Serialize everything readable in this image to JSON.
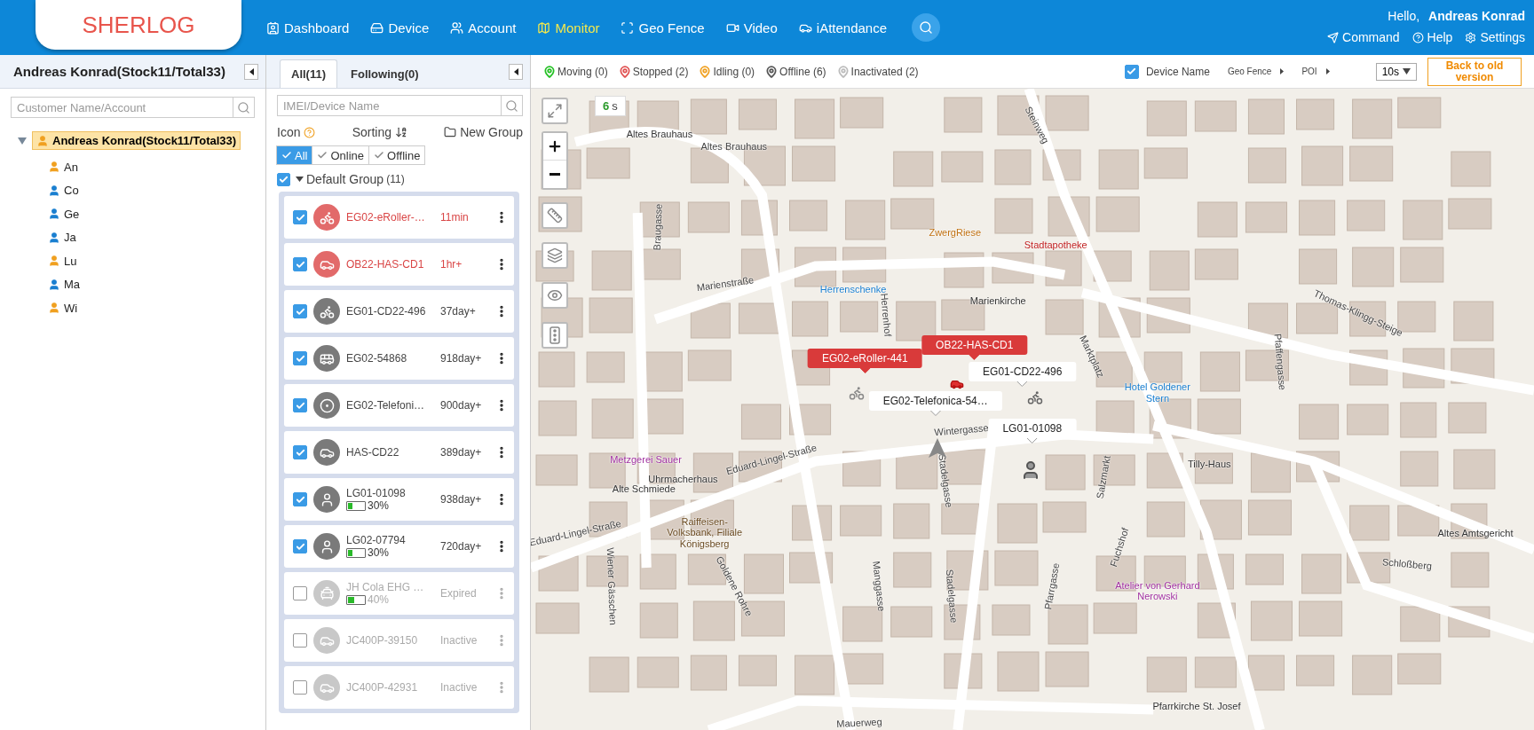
{
  "header": {
    "logo": "SHERLOG",
    "nav": [
      {
        "label": "Dashboard",
        "selected": false
      },
      {
        "label": "Device",
        "selected": false
      },
      {
        "label": "Account",
        "selected": false
      },
      {
        "label": "Monitor",
        "selected": true
      },
      {
        "label": "Geo Fence",
        "selected": false
      },
      {
        "label": "Video",
        "selected": false
      },
      {
        "label": "iAttendance",
        "selected": false
      }
    ],
    "greeting": "Hello,",
    "user": "Andreas Konrad",
    "links": [
      "Command",
      "Help",
      "Settings"
    ]
  },
  "customers": {
    "title": "Andreas Konrad(Stock11/Total33)",
    "search": {
      "placeholder": "Customer Name/Account"
    },
    "tree": [
      {
        "label": "Andreas Konrad(Stock11/Total33)",
        "color": "#f0a020",
        "expanded": true,
        "selected": true,
        "children": [
          {
            "label": "An",
            "color": "#f0a020",
            "selected": false
          },
          {
            "label": "Co",
            "color": "#1a7fd0",
            "selected": false
          },
          {
            "label": "Ge",
            "color": "#1a7fd0",
            "selected": false
          },
          {
            "label": "Ja",
            "color": "#1a7fd0",
            "selected": false
          },
          {
            "label": "Lu",
            "color": "#f0a020",
            "selected": false
          },
          {
            "label": "Ma",
            "color": "#1a7fd0",
            "selected": false
          },
          {
            "label": "Wi",
            "color": "#f0a020",
            "selected": false
          }
        ]
      }
    ]
  },
  "devices": {
    "tabs": [
      {
        "label": "All(11)",
        "selected": true
      },
      {
        "label": "Following(0)",
        "selected": false
      }
    ],
    "search": {
      "placeholder": "IMEI/Device Name"
    },
    "icon_label": "Icon",
    "sorting_label": "Sorting",
    "new_group": "New Group",
    "filters": [
      {
        "label": "All",
        "selected": true
      },
      {
        "label": "Online",
        "selected": false
      },
      {
        "label": "Offline",
        "selected": false
      }
    ],
    "group": {
      "name": "Default Group",
      "count": "(11)",
      "checked": true,
      "expanded": true
    },
    "rows": [
      {
        "name": "EG02-eRoller-…",
        "time": "11min",
        "kind": "motorbike",
        "alarm": true,
        "disabled": false,
        "checked": true
      },
      {
        "name": "OB22-HAS-CD1",
        "time": "1hr+",
        "kind": "car",
        "alarm": true,
        "disabled": false,
        "checked": true
      },
      {
        "name": "EG01-CD22-496",
        "time": "37day+",
        "kind": "motorbike",
        "alarm": false,
        "disabled": false,
        "checked": true
      },
      {
        "name": "EG02-54868",
        "time": "918day+",
        "kind": "bus",
        "alarm": false,
        "disabled": false,
        "checked": true
      },
      {
        "name": "EG02-Telefoni…",
        "time": "900day+",
        "kind": "target",
        "alarm": false,
        "disabled": false,
        "checked": true
      },
      {
        "name": "HAS-CD22",
        "time": "389day+",
        "kind": "car",
        "alarm": false,
        "disabled": false,
        "checked": true
      },
      {
        "name": "LG01-01098",
        "battery": "30%",
        "level": 0.3,
        "time": "938day+",
        "kind": "person",
        "alarm": false,
        "disabled": false,
        "checked": true
      },
      {
        "name": "LG02-07794",
        "battery": "30%",
        "level": 0.3,
        "time": "720day+",
        "kind": "person",
        "alarm": false,
        "disabled": false,
        "checked": true
      },
      {
        "name": "JH Cola EHG …",
        "battery": "40%",
        "level": 0.4,
        "time": "Expired",
        "kind": "taxi",
        "alarm": false,
        "disabled": true,
        "checked": false
      },
      {
        "name": "JC400P-39150",
        "time": "Inactive",
        "kind": "car",
        "alarm": false,
        "disabled": true,
        "checked": false
      },
      {
        "name": "JC400P-42931",
        "time": "Inactive",
        "kind": "car",
        "alarm": false,
        "disabled": true,
        "checked": false
      }
    ]
  },
  "map": {
    "legend": [
      {
        "label": "Moving (0)",
        "color": "#22c022"
      },
      {
        "label": "Stopped (2)",
        "color": "#e05050"
      },
      {
        "label": "Idling (0)",
        "color": "#f0a020"
      },
      {
        "label": "Offline (6)",
        "color": "#555555"
      },
      {
        "label": "Inactivated (2)",
        "color": "#bbbbbb"
      }
    ],
    "device_name": {
      "label": "Device Name",
      "checked": true
    },
    "geo_fence": "Geo Fence",
    "poi": "POI",
    "refresh": "10s",
    "back_button": "Back to old version",
    "countdown_value": "6",
    "countdown_unit": "s",
    "labels": [
      {
        "text": "Altes Brauhaus",
        "kind": "street"
      },
      {
        "text": "Altes Brauhaus",
        "kind": "place"
      },
      {
        "text": "Steinweg",
        "kind": "street"
      },
      {
        "text": "Braugasse",
        "kind": "street"
      },
      {
        "text": "Marienstraße",
        "kind": "street"
      },
      {
        "text": "Herrenschenke",
        "kind": "hotel"
      },
      {
        "text": "Herrenhof",
        "kind": "street"
      },
      {
        "text": "ZwergRiese",
        "kind": "cafe"
      },
      {
        "text": "Stadtapotheke",
        "kind": "pharmacy"
      },
      {
        "text": "Marienkirche",
        "kind": "place"
      },
      {
        "text": "Thomas-Klingg-Steige",
        "kind": "street"
      },
      {
        "text": "Marktplatz",
        "kind": "street"
      },
      {
        "text": "Metzgerei Sauer",
        "kind": "shop"
      },
      {
        "text": "Uhrmacherhaus",
        "kind": "place"
      },
      {
        "text": "Eduard-Lingel-Straße",
        "kind": "street"
      },
      {
        "text": "Alte Schmiede",
        "kind": "place"
      },
      {
        "text": "Raiffeisen-Volksbank, Filiale Königsberg",
        "kind": "bank"
      },
      {
        "text": "Eduard-Lingel-Straße",
        "kind": "street"
      },
      {
        "text": "Wiener Gässchen",
        "kind": "street"
      },
      {
        "text": "Goldene Rohre",
        "kind": "street"
      },
      {
        "text": "Manggasse",
        "kind": "street"
      },
      {
        "text": "Stadelgasse",
        "kind": "street"
      },
      {
        "text": "Stadelgasse",
        "kind": "street"
      },
      {
        "text": "Pfarrgasse",
        "kind": "street"
      },
      {
        "text": "Salzmarkt",
        "kind": "street"
      },
      {
        "text": "Fuchshof",
        "kind": "street"
      },
      {
        "text": "Hotel Goldener Stern",
        "kind": "hotel"
      },
      {
        "text": "Tilly-Haus",
        "kind": "place"
      },
      {
        "text": "Altes Amtsgericht",
        "kind": "place"
      },
      {
        "text": "Schloßberg",
        "kind": "street"
      },
      {
        "text": "Atelier von Gerhard Nerowski",
        "kind": "shop"
      },
      {
        "text": "Pfarrkirche St. Josef",
        "kind": "place"
      },
      {
        "text": "Mauerweg",
        "kind": "street"
      },
      {
        "text": "Pfaffengasse",
        "kind": "street"
      },
      {
        "text": "Wintergasse",
        "kind": "street"
      }
    ],
    "tags": [
      {
        "text": "EG02-eRoller-441",
        "alarm": true
      },
      {
        "text": "OB22-HAS-CD1",
        "alarm": true
      },
      {
        "text": "EG01-CD22-496",
        "alarm": false
      },
      {
        "text": "EG02-Telefonica-54…",
        "alarm": false
      },
      {
        "text": "LG01-01098",
        "alarm": false
      }
    ]
  }
}
